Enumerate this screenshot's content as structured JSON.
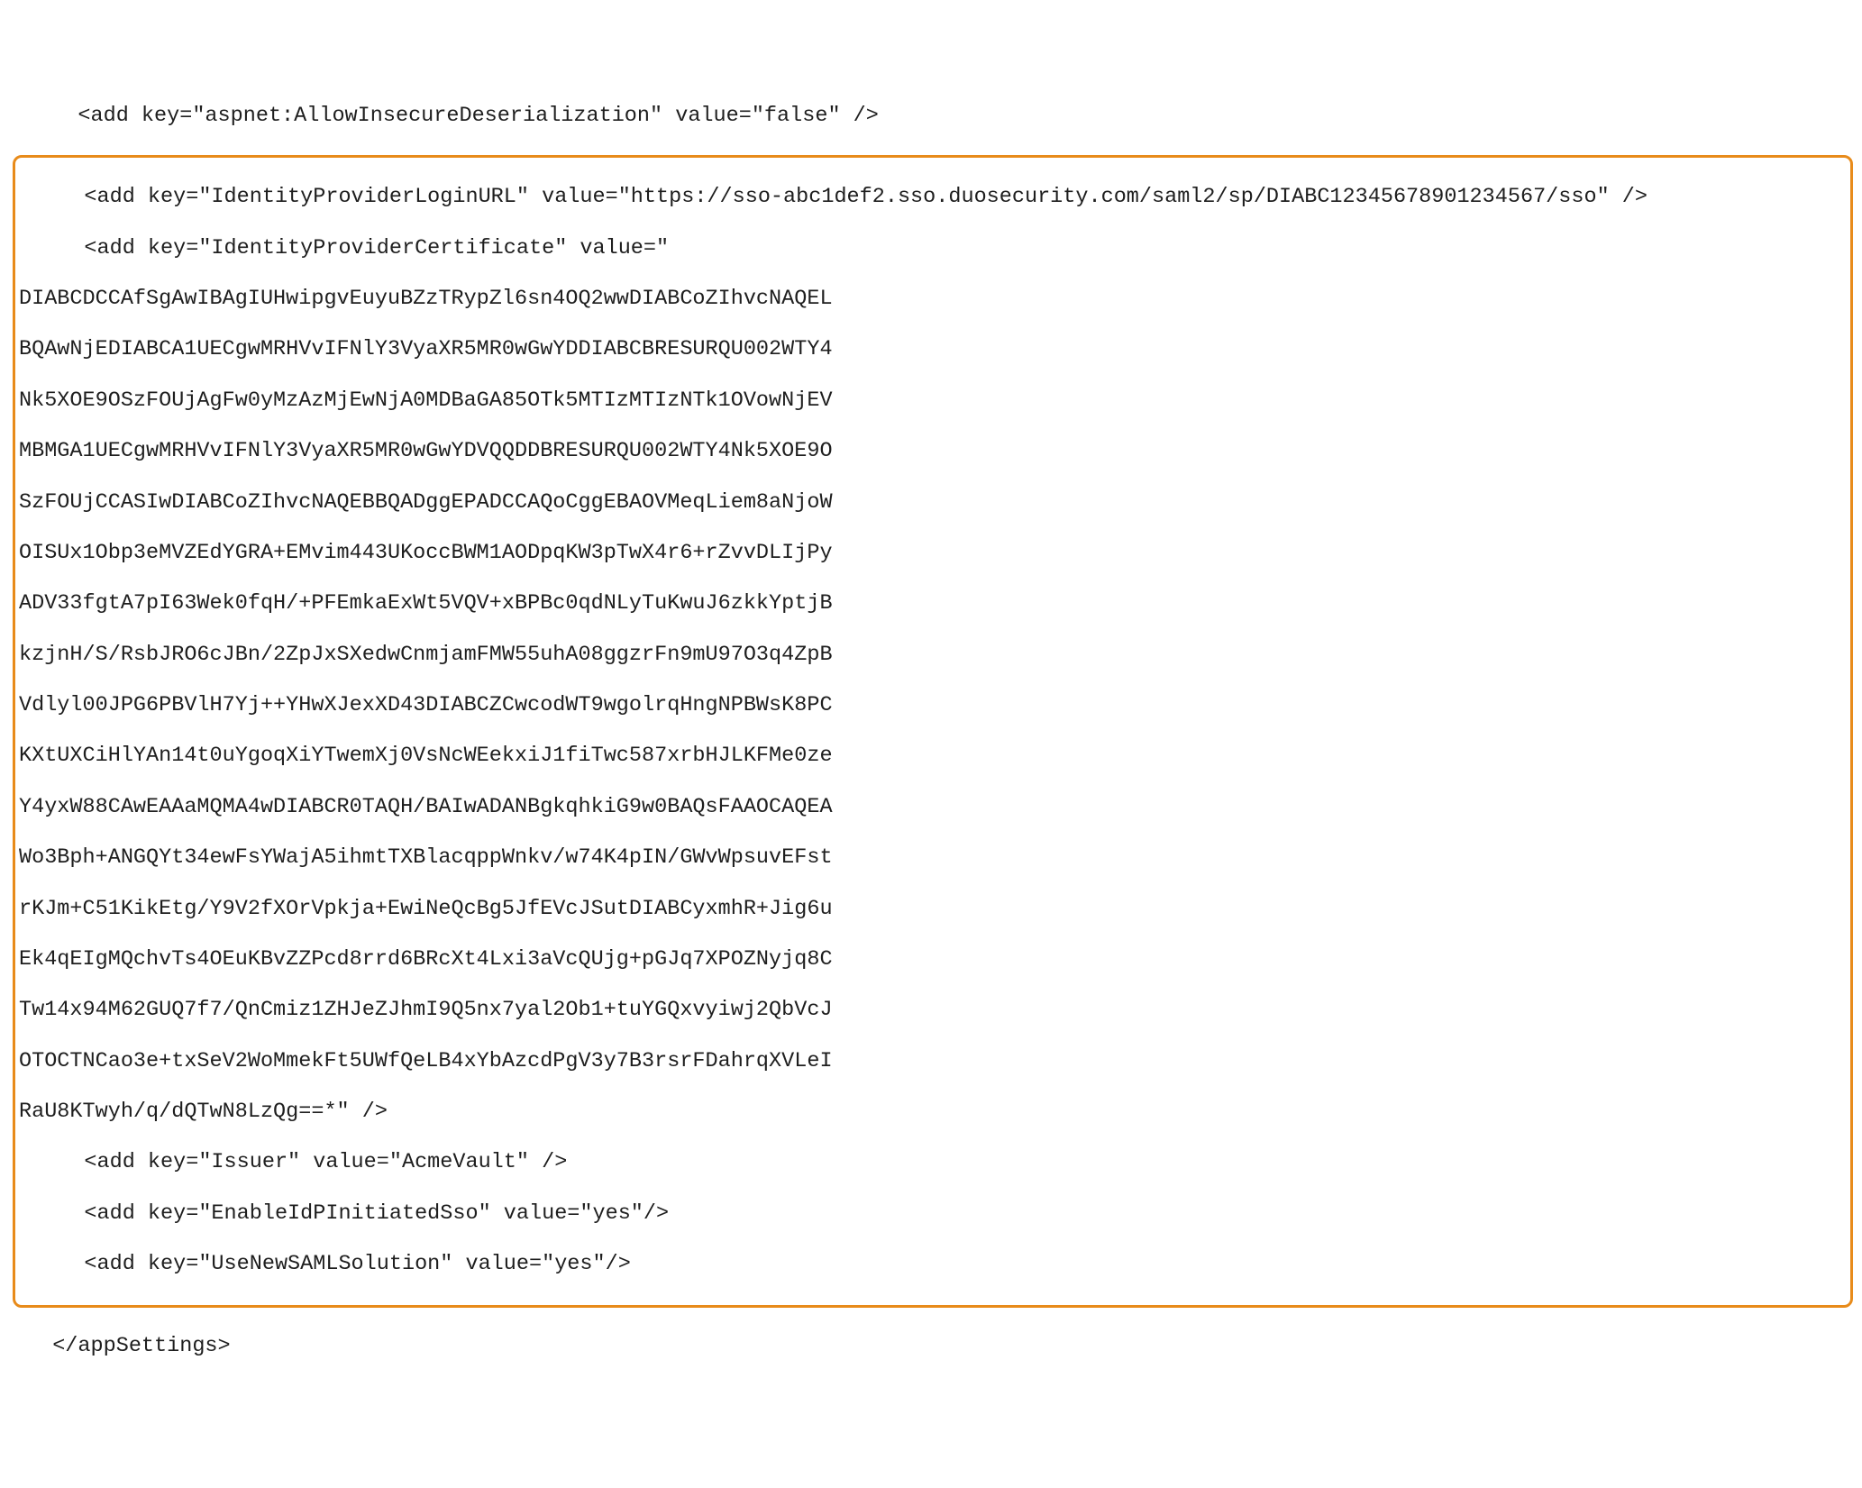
{
  "lines": {
    "l0": "    <add key=\"aspnet:AllowInsecureDeserialization\" value=\"false\" />",
    "l1": "    <add key=\"IdentityProviderLoginURL\" value=\"https://sso-abc1def2.sso.duosecurity.com/saml2/sp/DIABC12345678901234567/sso\" />",
    "l2": "    <add key=\"IdentityProviderCertificate\" value=\"",
    "l3": "DIABCDCCAfSgAwIBAgIUHwipgvEuyuBZzTRypZl6sn4OQ2wwDIABCoZIhvcNAQEL",
    "l4": "BQAwNjEDIABCA1UECgwMRHVvIFNlY3VyaXR5MR0wGwYDDIABCBRESURQU002WTY4",
    "l5": "Nk5XOE9OSzFOUjAgFw0yMzAzMjEwNjA0MDBaGA85OTk5MTIzMTIzNTk1OVowNjEV",
    "l6": "MBMGA1UECgwMRHVvIFNlY3VyaXR5MR0wGwYDVQQDDBRESURQU002WTY4Nk5XOE9O",
    "l7": "SzFOUjCCASIwDIABCoZIhvcNAQEBBQADggEPADCCAQoCggEBAOVMeqLiem8aNjoW",
    "l8": "OISUx1Obp3eMVZEdYGRA+EMvim443UKoccBWM1AODpqKW3pTwX4r6+rZvvDLIjPy",
    "l9": "ADV33fgtA7pI63Wek0fqH/+PFEmkaExWt5VQV+xBPBc0qdNLyTuKwuJ6zkkYptjB",
    "l10": "kzjnH/S/RsbJRO6cJBn/2ZpJxSXedwCnmjamFMW55uhA08ggzrFn9mU97O3q4ZpB",
    "l11": "Vdlyl00JPG6PBVlH7Yj++YHwXJexXD43DIABCZCwcodWT9wgolrqHngNPBWsK8PC",
    "l12": "KXtUXCiHlYAn14t0uYgoqXiYTwemXj0VsNcWEekxiJ1fiTwc587xrbHJLKFMe0ze",
    "l13": "Y4yxW88CAwEAAaMQMA4wDIABCR0TAQH/BAIwADANBgkqhkiG9w0BAQsFAAOCAQEA",
    "l14": "Wo3Bph+ANGQYt34ewFsYWajA5ihmtTXBlacqppWnkv/w74K4pIN/GWvWpsuvEFst",
    "l15": "rKJm+C51KikEtg/Y9V2fXOrVpkja+EwiNeQcBg5JfEVcJSutDIABCyxmhR+Jig6u",
    "l16": "Ek4qEIgMQchvTs4OEuKBvZZPcd8rrd6BRcXt4Lxi3aVcQUjg+pGJq7XPOZNyjq8C",
    "l17": "Tw14x94M62GUQ7f7/QnCmiz1ZHJeZJhmI9Q5nx7yal2Ob1+tuYGQxvyiwj2QbVcJ",
    "l18": "OTOCTNCao3e+txSeV2WoMmekFt5UWfQeLB4xYbAzcdPgV3y7B3rsrFDahrqXVLeI",
    "l19": "RaU8KTwyh/q/dQTwN8LzQg==*\" />",
    "l20": "    <add key=\"Issuer\" value=\"AcmeVault\" />",
    "l21": "    <add key=\"EnableIdPInitiatedSso\" value=\"yes\"/>",
    "l22": "    <add key=\"UseNewSAMLSolution\" value=\"yes\"/>",
    "l23": "  </appSettings>"
  }
}
